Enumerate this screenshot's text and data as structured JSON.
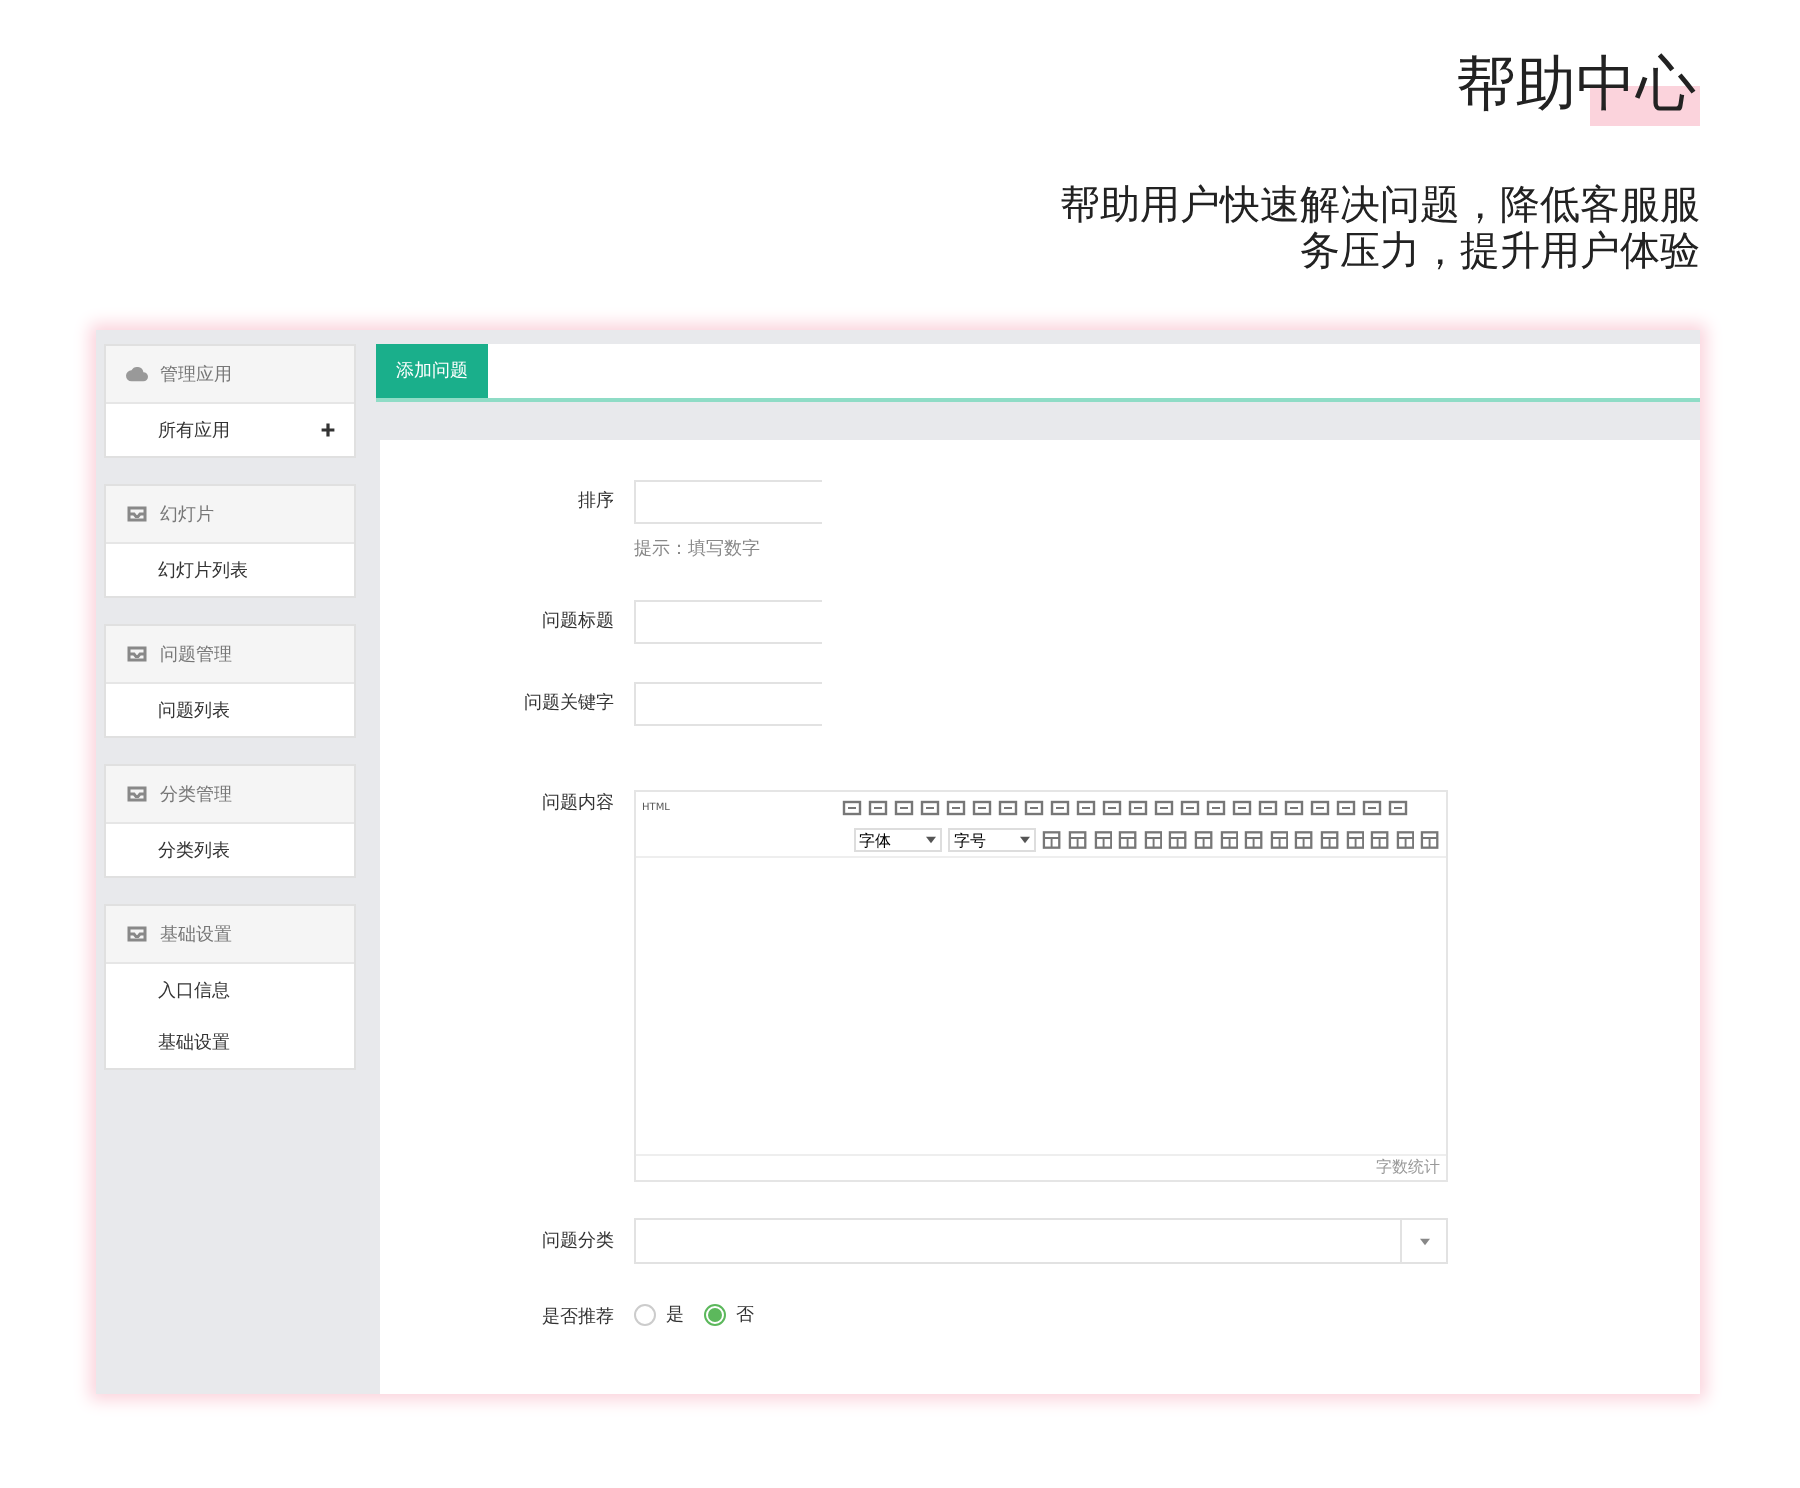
{
  "header": {
    "title": "帮助中心",
    "subtitle": "帮助用户快速解决问题，降低客服服务压力，提升用户体验"
  },
  "sidebar": [
    {
      "title": "管理应用",
      "kind": "cloud",
      "items": [
        {
          "label": "所有应用",
          "add": true
        }
      ]
    },
    {
      "title": "幻灯片",
      "kind": "tray",
      "items": [
        {
          "label": "幻灯片列表",
          "add": false
        }
      ]
    },
    {
      "title": "问题管理",
      "kind": "tray",
      "items": [
        {
          "label": "问题列表",
          "add": false
        }
      ]
    },
    {
      "title": "分类管理",
      "kind": "tray",
      "items": [
        {
          "label": "分类列表",
          "add": false
        }
      ]
    },
    {
      "title": "基础设置",
      "kind": "tray",
      "items": [
        {
          "label": "入口信息",
          "add": false
        },
        {
          "label": "基础设置",
          "add": false
        }
      ]
    }
  ],
  "tabs": [
    {
      "label": "添加问题",
      "selected": true
    }
  ],
  "form": [
    {
      "kind": "text",
      "label": "排序",
      "hint": "提示：填写数字"
    },
    {
      "kind": "text",
      "label": "问题标题"
    },
    {
      "kind": "text",
      "label": "问题关键字"
    },
    {
      "kind": "editor",
      "label": "问题内容",
      "toolbar_label": "HTML",
      "fonts": [
        "字体",
        "字号"
      ],
      "word_count": "字数统计"
    },
    {
      "kind": "select",
      "label": "问题分类"
    },
    {
      "kind": "radio",
      "label": "是否推荐",
      "options": [
        {
          "label": "是",
          "selected": false
        },
        {
          "label": "否",
          "selected": true
        }
      ]
    }
  ]
}
